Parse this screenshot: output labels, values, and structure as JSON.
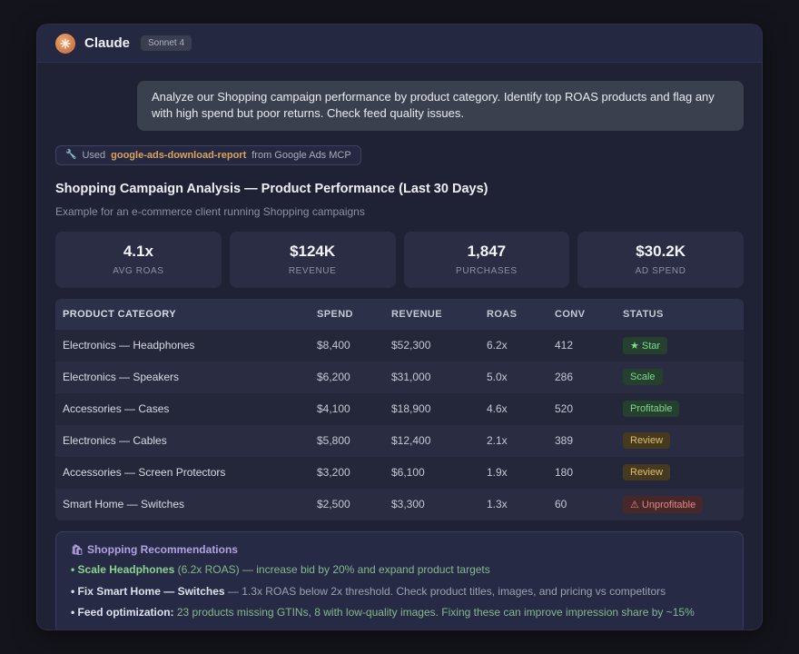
{
  "header": {
    "app_name": "Claude",
    "model_badge": "Sonnet 4"
  },
  "conversation": {
    "user_message": "Analyze our Shopping campaign performance by product category. Identify top ROAS products and flag any with high spend but poor returns. Check feed quality issues."
  },
  "tool_chip": {
    "icon_char": "🔧",
    "used_label": "Used",
    "tool_name": "google-ads-download-report",
    "source_label": "from Google Ads MCP"
  },
  "report": {
    "title": "Shopping Campaign Analysis — Product Performance (Last 30 Days)",
    "subtitle": "Example for an e-commerce client running Shopping campaigns"
  },
  "stats": [
    {
      "value": "4.1x",
      "label": "AVG ROAS"
    },
    {
      "value": "$124K",
      "label": "REVENUE"
    },
    {
      "value": "1,847",
      "label": "PURCHASES"
    },
    {
      "value": "$30.2K",
      "label": "AD SPEND"
    }
  ],
  "table": {
    "columns": [
      "PRODUCT CATEGORY",
      "SPEND",
      "REVENUE",
      "ROAS",
      "CONV",
      "STATUS"
    ],
    "rows": [
      {
        "category": "Electronics — Headphones",
        "spend": "$8,400",
        "revenue": "$52,300",
        "roas": "6.2x",
        "conv": "412",
        "status": "★ Star",
        "tone": "green"
      },
      {
        "category": "Electronics — Speakers",
        "spend": "$6,200",
        "revenue": "$31,000",
        "roas": "5.0x",
        "conv": "286",
        "status": "Scale",
        "tone": "green"
      },
      {
        "category": "Accessories — Cases",
        "spend": "$4,100",
        "revenue": "$18,900",
        "roas": "4.6x",
        "conv": "520",
        "status": "Profitable",
        "tone": "green"
      },
      {
        "category": "Electronics — Cables",
        "spend": "$5,800",
        "revenue": "$12,400",
        "roas": "2.1x",
        "conv": "389",
        "status": "Review",
        "tone": "yellow"
      },
      {
        "category": "Accessories — Screen Protectors",
        "spend": "$3,200",
        "revenue": "$6,100",
        "roas": "1.9x",
        "conv": "180",
        "status": "Review",
        "tone": "yellow"
      },
      {
        "category": "Smart Home — Switches",
        "spend": "$2,500",
        "revenue": "$3,300",
        "roas": "1.3x",
        "conv": "60",
        "status": "⚠ Unprofitable",
        "tone": "red"
      }
    ]
  },
  "recommendations": {
    "icon_char": "🛍",
    "title": "Shopping Recommendations",
    "items": [
      {
        "lead": "• Scale Headphones",
        "rest": " (6.2x ROAS) — increase bid by 20% and expand product targets",
        "lead_tone": "green",
        "rest_tone": "green"
      },
      {
        "lead": "• Fix Smart Home — Switches",
        "rest": " — 1.3x ROAS below 2x threshold. Check product titles, images, and pricing vs competitors",
        "lead_tone": "neutral",
        "rest_tone": "neutral"
      },
      {
        "lead": "• Feed optimization:",
        "rest": " 23 products missing GTINs, 8 with low-quality images. Fixing these can improve impression share by ~15%",
        "lead_tone": "neutral",
        "rest_tone": "green"
      }
    ]
  },
  "colors": {
    "accent_orange": "#d97b4d",
    "tool_name_amber": "#d9a45f",
    "status_green": "#7ed98d",
    "status_yellow": "#e3bf6b",
    "status_red": "#e58680",
    "recs_lavender": "#b2a3e0",
    "card_bg": "#1f2134",
    "page_bg": "#14141c"
  }
}
